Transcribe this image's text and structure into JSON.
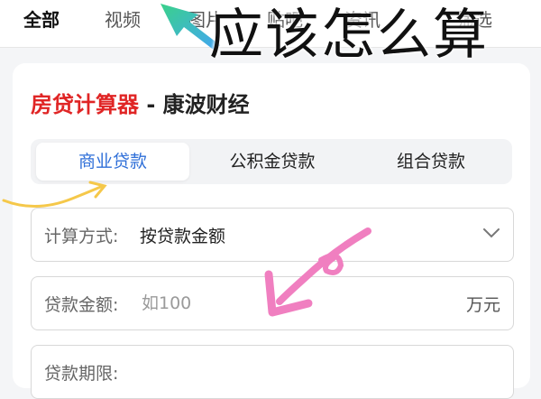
{
  "top_tabs": [
    "全部",
    "视频",
    "图片",
    "贴吧",
    "资讯",
    "筛选"
  ],
  "overlay_title": "应该怎么算",
  "card": {
    "title_red": "房贷计算器",
    "title_rest": " - 康波财经"
  },
  "loan_tabs": [
    "商业贷款",
    "公积金贷款",
    "组合贷款"
  ],
  "fields": {
    "method_label": "计算方式:",
    "method_value": "按贷款金额",
    "amount_label": "贷款金额:",
    "amount_placeholder": "如100",
    "amount_unit": "万元",
    "rate_label": "贷款期限:"
  },
  "colors": {
    "brand_red": "#e02525",
    "active_blue": "#2f6fd8",
    "doodle_pink": "#f07fc0",
    "doodle_yellow": "#f5c84a",
    "arrow_green": "#3ad18a"
  }
}
